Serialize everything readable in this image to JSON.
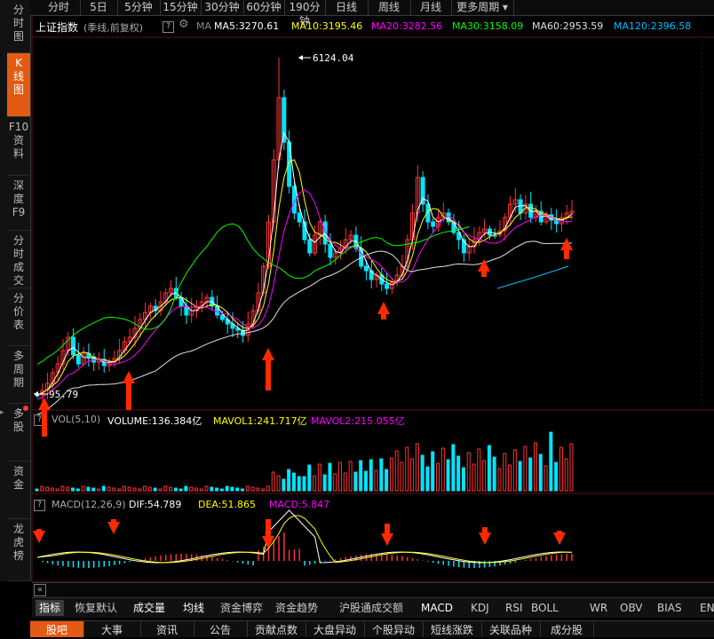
{
  "sidebar": {
    "items": [
      {
        "label": "分时图",
        "lines": [
          "分",
          "时",
          "图"
        ]
      },
      {
        "label": "K线图",
        "lines": [
          "K",
          "线",
          "图"
        ]
      },
      {
        "label": "F10资料",
        "lines": [
          "F10",
          "资",
          "料"
        ]
      },
      {
        "label": "深度F9",
        "lines": [
          "深",
          "度",
          "F9"
        ]
      },
      {
        "label": "分时成交",
        "lines": [
          "分",
          "时",
          "成",
          "交"
        ]
      },
      {
        "label": "分价表",
        "lines": [
          "分",
          "价",
          "表"
        ]
      },
      {
        "label": "多周期",
        "lines": [
          "多",
          "周",
          "期"
        ]
      },
      {
        "label": "多股",
        "lines": [
          "多",
          "股"
        ]
      },
      {
        "label": "资金",
        "lines": [
          "资",
          "金"
        ]
      },
      {
        "label": "龙虎榜",
        "lines": [
          "龙",
          "虎",
          "榜"
        ]
      }
    ]
  },
  "period_tabs": [
    "分时",
    "5日",
    "5分钟",
    "15分钟",
    "30分钟",
    "60分钟",
    "190分钟",
    "日线",
    "周线",
    "月线",
    "更多周期"
  ],
  "info": {
    "title": "上证指数",
    "subtitle": "(季线,前复权)",
    "ma_label": "MA",
    "ma5": "MA5:3270.61",
    "ma10": "MA10:3195.46",
    "ma20": "MA20:3282.56",
    "ma30": "MA30:3158.09",
    "ma60": "MA60:2953.59",
    "ma120": "MA120:2396.58"
  },
  "price_labels": {
    "high": "6124.04",
    "low": "95.79"
  },
  "vol_info": {
    "name": "VOL(5,10)",
    "volume": "VOLUME:136.384亿",
    "mavol1": "MAVOL1:241.717亿",
    "mavol2": "MAVOL2:215.055亿"
  },
  "macd_info": {
    "name": "MACD(12,26,9)",
    "dif": "DIF:54.789",
    "dea": "DEA:51.865",
    "macd": "MACD:5.847"
  },
  "indicator_bar": [
    "指标",
    "恢复默认",
    "成交量",
    "均线",
    "资金博弈",
    "资金趋势",
    "沪股通成交额",
    "MACD",
    "KDJ",
    "RSI",
    "BOLL",
    "WR",
    "OBV",
    "BIAS",
    "ENE"
  ],
  "bottom_tabs": [
    "股吧",
    "大事",
    "资讯",
    "公告",
    "贡献点数",
    "大盘异动",
    "个股异动",
    "短线涨跌",
    "关联品种",
    "成分股"
  ],
  "colors": {
    "up": "#ff3232",
    "down": "#00e5ff",
    "ma5": "#ffffff",
    "ma10": "#ffff00",
    "ma20": "#ff00ff",
    "ma30": "#00ff00",
    "ma60": "#e0e0e0",
    "ma120": "#00c0ff",
    "accent": "#e35a13",
    "arrow": "#ff2a00"
  },
  "chart_data": {
    "type": "candlestick",
    "high": 6124.04,
    "low": 95.79,
    "moving_averages": {
      "MA5": 3270.61,
      "MA10": 3195.46,
      "MA20": 3282.56,
      "MA30": 3158.09,
      "MA60": 2953.59,
      "MA120": 2396.58
    },
    "volume": {
      "VOLUME": "136.384亿",
      "MAVOL1": "241.717亿",
      "MAVOL2": "215.055亿"
    },
    "macd": {
      "DIF": 54.789,
      "DEA": 51.865,
      "MACD": 5.847
    }
  }
}
